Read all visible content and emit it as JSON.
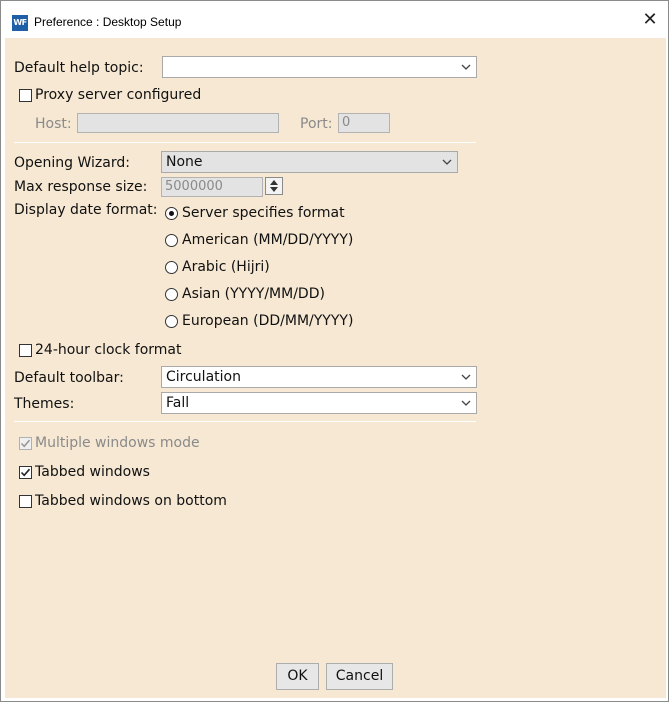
{
  "window": {
    "title": "Preference : Desktop Setup",
    "app_icon_text": "WF",
    "close_label": "✕"
  },
  "help_topic": {
    "label": "Default help topic:",
    "value": ""
  },
  "proxy": {
    "label": "Proxy server configured",
    "checked": false,
    "host_label": "Host:",
    "host_value": "",
    "port_label": "Port:",
    "port_value": "0"
  },
  "opening_wizard": {
    "label": "Opening Wizard:",
    "value": "None"
  },
  "max_response": {
    "label": "Max response size:",
    "value": "5000000"
  },
  "date_format": {
    "label": "Display date format:",
    "options": [
      {
        "label": "Server specifies format",
        "selected": true
      },
      {
        "label": "American (MM/DD/YYYY)",
        "selected": false
      },
      {
        "label": "Arabic (Hijri)",
        "selected": false
      },
      {
        "label": "Asian (YYYY/MM/DD)",
        "selected": false
      },
      {
        "label": "European (DD/MM/YYYY)",
        "selected": false
      }
    ]
  },
  "clock24": {
    "label": "24-hour clock format",
    "checked": false
  },
  "default_toolbar": {
    "label": "Default toolbar:",
    "value": "Circulation"
  },
  "themes": {
    "label": "Themes:",
    "value": "Fall"
  },
  "multiple_windows": {
    "label": "Multiple windows mode",
    "checked": true,
    "disabled": true
  },
  "tabbed_windows": {
    "label": "Tabbed windows",
    "checked": true
  },
  "tabbed_bottom": {
    "label": "Tabbed windows on bottom",
    "checked": false
  },
  "buttons": {
    "ok": "OK",
    "cancel": "Cancel"
  },
  "colors": {
    "background": "#f6e8d3",
    "field_disabled": "#e3e3e3"
  }
}
